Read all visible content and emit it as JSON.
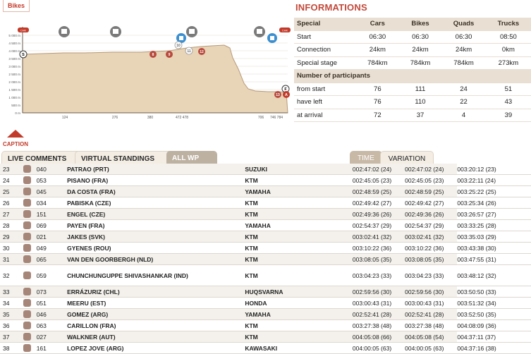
{
  "header": {
    "tab_label": "Bikes",
    "info_title": "INFORMATIONS"
  },
  "profile": {
    "start_badge": "S",
    "finish_badge": "F",
    "arrival_badge": "A",
    "left_top_badge": "CHK",
    "right_top_badge": "CHK",
    "y_labels": [
      "5 000 m",
      "4 500 m",
      "4 000 m",
      "3 500 m",
      "3 000 m",
      "2 500 m",
      "2 000 m",
      "1 500 m",
      "1 000 m",
      "500 m",
      "0 m"
    ],
    "x_labels": [
      "124",
      "276",
      "380",
      "472 478",
      "706",
      "746 784"
    ],
    "waypoints": [
      "8",
      "9",
      "10",
      "11",
      "12",
      "13"
    ],
    "icons": [
      "gas",
      "gas",
      "gas",
      "gas",
      "gas"
    ]
  },
  "info": {
    "headers": [
      "Special",
      "Cars",
      "Bikes",
      "Quads",
      "Trucks"
    ],
    "rows": [
      [
        "Start",
        "06:30",
        "06:30",
        "06:30",
        "08:50"
      ],
      [
        "Connection",
        "24km",
        "24km",
        "24km",
        "0km"
      ],
      [
        "Special stage",
        "784km",
        "784km",
        "784km",
        "273km"
      ]
    ],
    "participants_header": "Number of participants",
    "participants": [
      [
        "from start",
        "76",
        "111",
        "24",
        "51"
      ],
      [
        "have left",
        "76",
        "110",
        "22",
        "43"
      ],
      [
        "at arrival",
        "72",
        "37",
        "4",
        "39"
      ]
    ]
  },
  "caption_label": "CAPTION",
  "tabs": {
    "live": "LIVE COMMENTS",
    "virtual": "VIRTUAL STANDINGS",
    "allwp": "ALL WP",
    "time": "TIME",
    "variation": "VARIATION"
  },
  "standings": [
    [
      "23",
      "040",
      "PATRAO (PRT)",
      "SUZUKI",
      "002:47:02 (24)",
      "002:47:02 (24)",
      "003:20:12 (23)"
    ],
    [
      "24",
      "053",
      "PISANO (FRA)",
      "KTM",
      "002:45:05 (23)",
      "002:45:05 (23)",
      "003:22:11 (24)"
    ],
    [
      "25",
      "045",
      "DA COSTA (FRA)",
      "YAMAHA",
      "002:48:59 (25)",
      "002:48:59 (25)",
      "003:25:22 (25)"
    ],
    [
      "26",
      "034",
      "PABISKA (CZE)",
      "KTM",
      "002:49:42 (27)",
      "002:49:42 (27)",
      "003:25:34 (26)"
    ],
    [
      "27",
      "151",
      "ENGEL (CZE)",
      "KTM",
      "002:49:36 (26)",
      "002:49:36 (26)",
      "003:26:57 (27)"
    ],
    [
      "28",
      "069",
      "PAYEN (FRA)",
      "YAMAHA",
      "002:54:37 (29)",
      "002:54:37 (29)",
      "003:33:25 (28)"
    ],
    [
      "29",
      "021",
      "JAKES (SVK)",
      "KTM",
      "003:02:41 (32)",
      "003:02:41 (32)",
      "003:35:03 (29)"
    ],
    [
      "30",
      "049",
      "GYENES (ROU)",
      "KTM",
      "003:10:22 (36)",
      "003:10:22 (36)",
      "003:43:38 (30)"
    ],
    [
      "31",
      "065",
      "VAN DEN GOORBERGH (NLD)",
      "KTM",
      "003:08:05 (35)",
      "003:08:05 (35)",
      "003:47:55 (31)"
    ],
    [
      "32",
      "059",
      "CHUNCHUNGUPPE SHIVASHANKAR (IND)",
      "KTM",
      "003:04:23 (33)",
      "003:04:23 (33)",
      "003:48:12 (32)"
    ],
    [
      "33",
      "073",
      "ERRÁZURIZ (CHL)",
      "HUQSVARNA",
      "002:59:56 (30)",
      "002:59:56 (30)",
      "003:50:50 (33)"
    ],
    [
      "34",
      "051",
      "MEERU (EST)",
      "HONDA",
      "003:00:43 (31)",
      "003:00:43 (31)",
      "003:51:32 (34)"
    ],
    [
      "35",
      "046",
      "GOMEZ (ARG)",
      "YAMAHA",
      "002:52:41 (28)",
      "002:52:41 (28)",
      "003:52:50 (35)"
    ],
    [
      "36",
      "063",
      "CARILLON (FRA)",
      "KTM",
      "003:27:38 (48)",
      "003:27:38 (48)",
      "004:08:09 (36)"
    ],
    [
      "37",
      "027",
      "WALKNER (AUT)",
      "KTM",
      "004:05:08 (66)",
      "004:05:08 (54)",
      "004:37:11 (37)"
    ],
    [
      "38",
      "161",
      "LOPEZ JOVE (ARG)",
      "KAWASAKI",
      "004:00:05 (63)",
      "004:00:05 (63)",
      "004:37:16 (38)"
    ]
  ]
}
